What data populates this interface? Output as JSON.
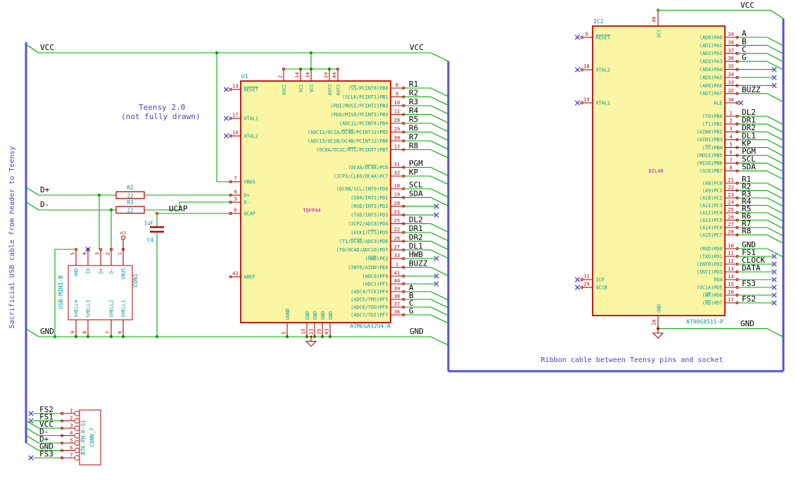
{
  "colors": {
    "wire": "#00a800",
    "bus": "#5551d8",
    "pin": "#b40404",
    "body": "#fbf6a3",
    "body_stroke": "#c00404",
    "conn_stroke": "#cc4848",
    "teal": "#009595",
    "note": "#4a42cc",
    "nc": "#3c3cd8",
    "magenta": "#c800c8",
    "label": "#000000"
  },
  "notes": {
    "sacrificial": "Sacrificial USB cable from header to Teensy",
    "teensy1": "Teensy 2.0",
    "teensy2": "(not fully drawn)",
    "ribbon": "Ribbon cable between Teensy pins and socket"
  },
  "net_labels": {
    "vcc": "VCC",
    "gnd": "GND",
    "dplus": "D+",
    "dminus": "D-",
    "ucap": "UCAP"
  },
  "u1": {
    "ref": "U1",
    "value": "ATMEGA32U4-A",
    "package": "TQFP44",
    "left_pins": [
      {
        "num": "13",
        "name": "~RESET~",
        "nc": true
      },
      {
        "num": "17",
        "name": "XTAL1",
        "nc": true
      },
      {
        "num": "16",
        "name": "XTAL2",
        "nc": true
      },
      {
        "num": "7",
        "name": "VBUS"
      },
      {
        "num": "4",
        "name": "D+"
      },
      {
        "num": "3",
        "name": "D-"
      },
      {
        "num": "6",
        "name": "UCAP"
      },
      {
        "num": "42",
        "name": "AREF"
      }
    ],
    "top_pins": [
      {
        "num": "2",
        "name": "UVCC"
      },
      {
        "num": "14",
        "name": "VCC"
      },
      {
        "num": "34",
        "name": "VCC"
      },
      {
        "num": "24",
        "name": "AVCC"
      },
      {
        "num": "44",
        "name": "AVCC"
      }
    ],
    "bottom_pins": [
      {
        "num": "5",
        "name": "UGND"
      },
      {
        "num": "15",
        "name": "GND"
      },
      {
        "num": "23",
        "name": "GND"
      },
      {
        "num": "35",
        "name": "GND"
      },
      {
        "num": "43",
        "name": "GND"
      }
    ],
    "right_groups": [
      [
        {
          "num": "8",
          "name": "(~SS~/PCINT0)PB0",
          "label": "R1"
        },
        {
          "num": "9",
          "name": "(SCLK/PCINT1)PB1",
          "label": "R2"
        },
        {
          "num": "10",
          "name": "(PDI/MOSI/PCINT2)PB2",
          "label": "R3"
        },
        {
          "num": "11",
          "name": "(PDO/MISO/PCINT3)PB3",
          "label": "R4"
        },
        {
          "num": "28",
          "name": "(ADC11/PCINT4)PB4",
          "label": "R5"
        },
        {
          "num": "29",
          "name": "(ADC12/OC1A/~OC4B~/PCINT12)PB5",
          "label": "R6"
        },
        {
          "num": "30",
          "name": "(ADC13/OC1B/OC4B/PCINT13)PB6",
          "label": "R7"
        },
        {
          "num": "12",
          "name": "(OC0A/OC1C/~RTS~/PCINT7)PB7",
          "label": "R8"
        }
      ],
      [
        {
          "num": "31",
          "name": "(OC3A/~OC4A~)PC6",
          "label": "PGM"
        },
        {
          "num": "32",
          "name": "(ICP3/CLKO/OC4A)PC7",
          "label": "KP"
        }
      ],
      [
        {
          "num": "18",
          "name": "(OC0B/SCL/INT0)PD0",
          "label": "SCL"
        },
        {
          "num": "19",
          "name": "(SDA/INT1)PD1",
          "label": "SDA"
        },
        {
          "num": "20",
          "name": "(RXD/INT2)PD2",
          "nc": true
        },
        {
          "num": "21",
          "name": "(TXD/INT3)PD3",
          "nc": true
        },
        {
          "num": "25",
          "name": "(ICP2/ADC8)PD4",
          "label": "DL2"
        },
        {
          "num": "22",
          "name": "(XCK1/~CTS~)PD5",
          "label": "DR1"
        },
        {
          "num": "26",
          "name": "(T1/~OC4D~/ADC9)PD6",
          "label": "DR2"
        },
        {
          "num": "27",
          "name": "(T0/OC4D/ADC10)PD7",
          "label": "DL1"
        }
      ],
      [
        {
          "num": "33",
          "name": "(~HWB~)PE2",
          "label": "HWB",
          "nc": true
        },
        {
          "num": "1",
          "name": "(INT6/AIN0)PE6",
          "label": "BUZZ"
        }
      ],
      [
        {
          "num": "41",
          "name": "(ADC0)PF0",
          "nc": true
        },
        {
          "num": "40",
          "name": "(ADC1)PF1",
          "nc": true
        },
        {
          "num": "39",
          "name": "(ADC4/TCK)PF4",
          "label": "A"
        },
        {
          "num": "38",
          "name": "(ADC5/TMS)PF5",
          "label": "B"
        },
        {
          "num": "37",
          "name": "(ADC6/TDO)PF6",
          "label": "C"
        },
        {
          "num": "36",
          "name": "(ADC7/TDI)PF7",
          "label": "G"
        }
      ]
    ]
  },
  "ic2": {
    "ref": "IC2",
    "value": "AT90S8515-P",
    "package": "DIL40",
    "left_pins": [
      {
        "num": "9",
        "name": "~RESET~",
        "nc": true
      },
      {
        "num": "18",
        "name": "XTAL2",
        "nc": true
      },
      {
        "num": "19",
        "name": "XTAL1",
        "nc": true
      },
      {
        "num": "31",
        "name": "ICP",
        "nc": true
      },
      {
        "num": "29",
        "name": "OC1B",
        "nc": true
      }
    ],
    "top_pins": [
      {
        "num": "40",
        "name": "VCC"
      }
    ],
    "bottom_pins": [
      {
        "num": "20",
        "name": "GND"
      }
    ],
    "right_groups": [
      [
        {
          "num": "39",
          "name": "(AD0)PA0",
          "label": "A"
        },
        {
          "num": "38",
          "name": "(AD1)PA1",
          "label": "B"
        },
        {
          "num": "37",
          "name": "(AD2)PA2",
          "label": "C"
        },
        {
          "num": "36",
          "name": "(AD3)PA3",
          "label": "G"
        },
        {
          "num": "35",
          "name": "(AD4)PA4",
          "nc": true
        },
        {
          "num": "34",
          "name": "(AD5)PA5",
          "nc": true
        },
        {
          "num": "33",
          "name": "(AD6)PA6",
          "nc": true
        },
        {
          "num": "32",
          "name": "(AD7)PA7",
          "label": "BUZZ"
        }
      ],
      [
        {
          "num": "30",
          "name": "ALE",
          "ncstub": true
        }
      ],
      [
        {
          "num": "1",
          "name": "(T0)PB0",
          "label": "DL2"
        },
        {
          "num": "2",
          "name": "(T1)PB1",
          "label": "DR1"
        },
        {
          "num": "3",
          "name": "(AIN0)PB2",
          "label": "DR2"
        },
        {
          "num": "4",
          "name": "(AIN1)PB3",
          "label": "DL1"
        },
        {
          "num": "5",
          "name": "(~SS~)PB4",
          "label": "KP"
        },
        {
          "num": "6",
          "name": "(MOSI)PB5",
          "label": "PGM"
        },
        {
          "num": "7",
          "name": "(MISO)PB6",
          "label": "SCL"
        },
        {
          "num": "8",
          "name": "(SCK)PB7",
          "label": "SDA"
        }
      ],
      [
        {
          "num": "21",
          "name": "(A8)PC0",
          "label": "R1"
        },
        {
          "num": "22",
          "name": "(A9)PC1",
          "label": "R2"
        },
        {
          "num": "23",
          "name": "(A10)PC2",
          "label": "R3"
        },
        {
          "num": "24",
          "name": "(A11)PC3",
          "label": "R4"
        },
        {
          "num": "25",
          "name": "(A12)PC4",
          "label": "R5"
        },
        {
          "num": "26",
          "name": "(A13)PC5",
          "label": "R6"
        },
        {
          "num": "27",
          "name": "(A14)PC6",
          "label": "R7"
        },
        {
          "num": "28",
          "name": "(A15)PC7",
          "label": "R8"
        }
      ],
      [
        {
          "num": "10",
          "name": "(RXD)PD0",
          "label": "GND"
        },
        {
          "num": "11",
          "name": "(TXD)PD1",
          "label": "FS1",
          "nc": true
        },
        {
          "num": "12",
          "name": "(INT0)PD2",
          "label": "CLOCK",
          "nc": true
        },
        {
          "num": "13",
          "name": "(INT1)PD3",
          "label": "DATA",
          "nc": true
        },
        {
          "num": "14",
          "name": "PD4",
          "nc": true
        },
        {
          "num": "15",
          "name": "(OC1A)PD5",
          "label": "FS3",
          "nc": true
        },
        {
          "num": "16",
          "name": "(~WR~)PD6",
          "nc": true
        },
        {
          "num": "17",
          "name": "(~RD~)PD7",
          "label": "FS2",
          "nc": true
        }
      ]
    ]
  },
  "con1": {
    "ref": "CON1",
    "value": "USB-MINI-B",
    "top_pins": [
      {
        "num": "5",
        "name": "GND"
      },
      {
        "num": "4",
        "name": "ID",
        "nc": true
      },
      {
        "num": "3",
        "name": "D+"
      },
      {
        "num": "2",
        "name": "D-"
      },
      {
        "num": "1",
        "name": "VBUS"
      }
    ],
    "bottom_pins": [
      {
        "num": "9",
        "name": "SHELL4"
      },
      {
        "num": "8",
        "name": "SHELL3"
      },
      {
        "num": "7",
        "name": "SHELL2"
      },
      {
        "num": "6",
        "name": "SHELL1"
      }
    ]
  },
  "conn7": {
    "ref": "CONN_7",
    "value": "B7K-PH-K-S1",
    "pins": [
      {
        "num": "1",
        "label": "FS2",
        "nc": true
      },
      {
        "num": "2",
        "label": "FS1",
        "nc": true
      },
      {
        "num": "3",
        "label": "VCC"
      },
      {
        "num": "4",
        "label": "D-"
      },
      {
        "num": "5",
        "label": "D+"
      },
      {
        "num": "6",
        "label": "GND"
      },
      {
        "num": "7",
        "label": "FS3",
        "nc": true
      }
    ]
  },
  "r2": {
    "ref": "R2",
    "value": "22"
  },
  "r3": {
    "ref": "R3",
    "value": "22"
  },
  "c4": {
    "ref": "C4",
    "value": "1uF"
  }
}
